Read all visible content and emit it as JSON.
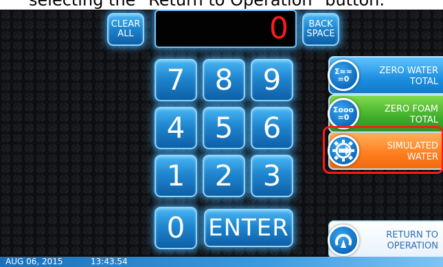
{
  "caption": "selecting the \"Return to Operation\" button.",
  "display": {
    "value": "0"
  },
  "keypad": {
    "clear_all": "CLEAR\nALL",
    "back_space": "BACK\nSPACE",
    "digits": [
      "7",
      "8",
      "9",
      "4",
      "5",
      "6",
      "1",
      "2",
      "3",
      "0"
    ],
    "enter": "ENTER"
  },
  "side_buttons": {
    "zero_water": {
      "label": "ZERO WATER\nTOTAL",
      "icon_text": "Σ≈≈\n=0"
    },
    "zero_foam": {
      "label": "ZERO FOAM\nTOTAL",
      "icon_text": "Σooo\n=0"
    },
    "simulated_water": {
      "label": "SIMULATED\nWATER"
    },
    "return_to_operation": {
      "label": "RETURN TO\nOPERATION"
    }
  },
  "status": {
    "date": "AUG 06, 2015",
    "time": "13:43.54"
  },
  "colors": {
    "key_blue": "#1f86cf",
    "display_red": "#ff1a1a",
    "zero_water": "#1c8ee0",
    "zero_foam": "#3fae2a",
    "simulated_water": "#ff7d1e",
    "highlight": "#ff1a1a"
  }
}
